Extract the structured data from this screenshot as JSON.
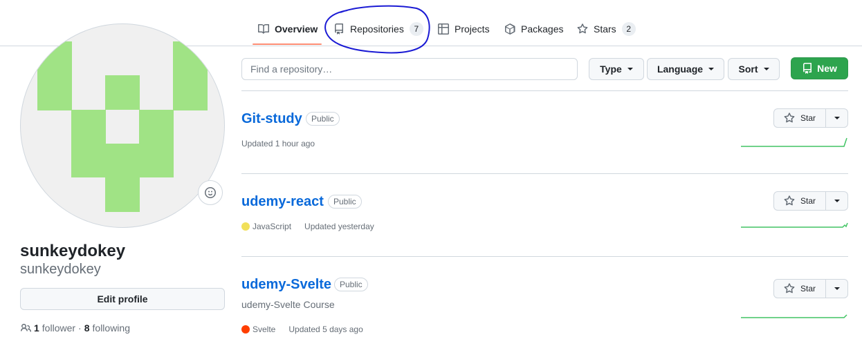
{
  "nav": {
    "tabs": [
      {
        "label": "Overview",
        "icon": "book-icon"
      },
      {
        "label": "Repositories",
        "count": "7",
        "icon": "repo-icon"
      },
      {
        "label": "Projects",
        "icon": "table-icon"
      },
      {
        "label": "Packages",
        "icon": "package-icon"
      },
      {
        "label": "Stars",
        "count": "2",
        "icon": "star-icon"
      }
    ],
    "active_tab": "Overview"
  },
  "profile": {
    "full_name": "sunkeydokey",
    "username": "sunkeydokey",
    "edit_label": "Edit profile",
    "followers_count": "1",
    "followers_label": "follower",
    "following_count": "8",
    "following_label": "following",
    "separator": "·"
  },
  "filters": {
    "search_placeholder": "Find a repository…",
    "type_label": "Type",
    "language_label": "Language",
    "sort_label": "Sort",
    "new_label": "New"
  },
  "repos": [
    {
      "name": "Git-study",
      "visibility": "Public",
      "description": "",
      "language": "",
      "language_color": "",
      "updated": "Updated 1 hour ago",
      "star_label": "Star"
    },
    {
      "name": "udemy-react",
      "visibility": "Public",
      "description": "",
      "language": "JavaScript",
      "language_color": "#f1e05a",
      "updated": "Updated yesterday",
      "star_label": "Star"
    },
    {
      "name": "udemy-Svelte",
      "visibility": "Public",
      "description": "udemy-Svelte Course",
      "language": "Svelte",
      "language_color": "#ff3e00",
      "updated": "Updated 5 days ago",
      "star_label": "Star"
    }
  ],
  "colors": {
    "accent_link": "#0969da",
    "new_button": "#2da44e",
    "avatar_identicon": "#a0e385",
    "active_tab_underline": "#fd8c73",
    "annotation_circle": "#1a1ad4"
  }
}
